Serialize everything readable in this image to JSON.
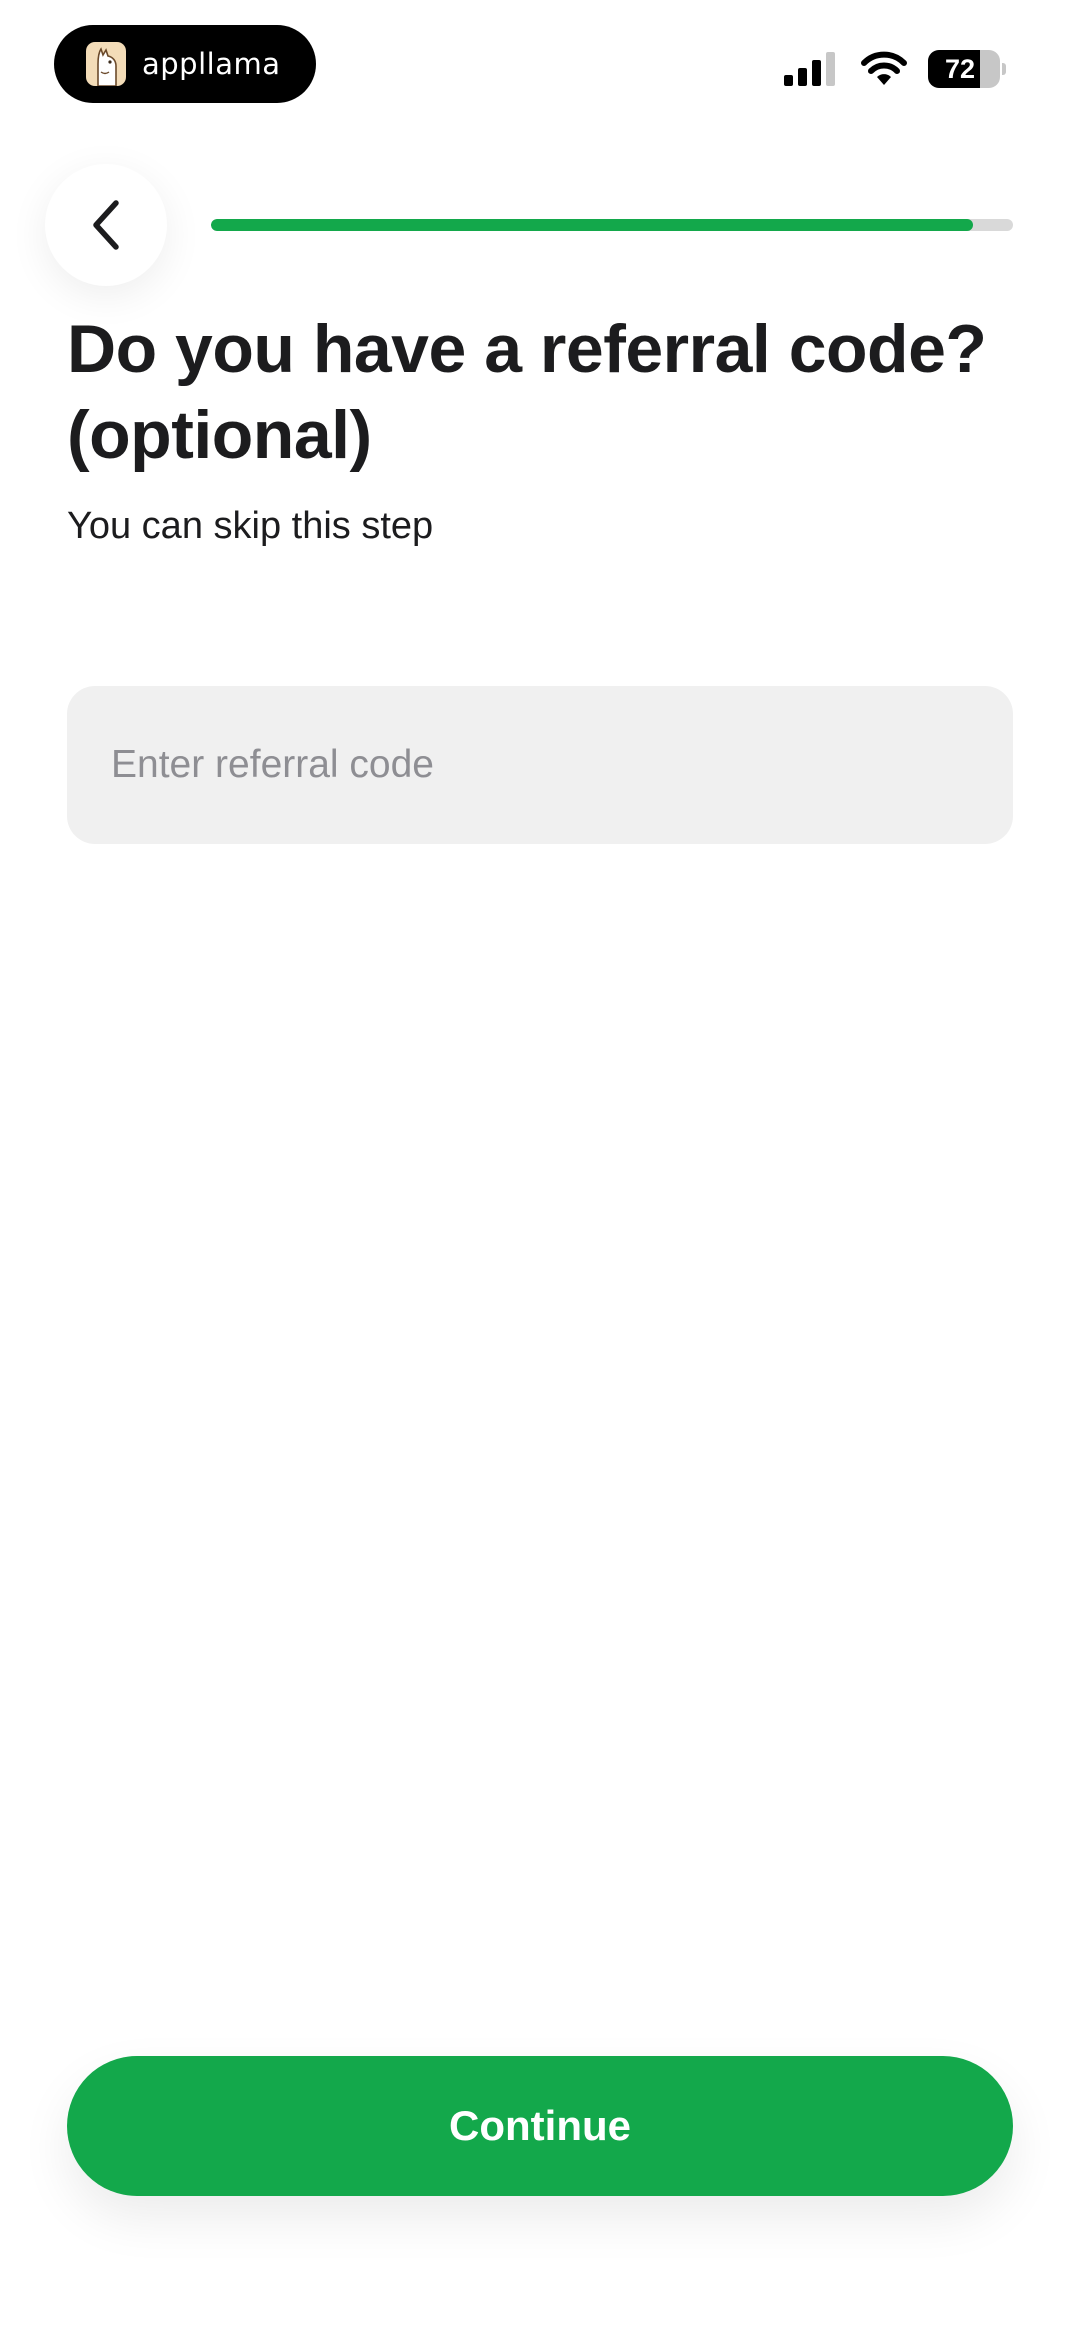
{
  "status_bar": {
    "app_pill": {
      "name": "appllama",
      "logo_icon": "llama-logo-icon"
    },
    "signal_icon": "cellular-signal-icon",
    "wifi_icon": "wifi-icon",
    "battery": {
      "icon": "battery-icon",
      "level_text": "72",
      "level_fraction": 0.72
    }
  },
  "header": {
    "back_icon": "chevron-left-icon",
    "progress_fraction": 0.95
  },
  "main": {
    "title": "Do you have a referral code? (optional)",
    "subtitle": "You can skip this step",
    "referral_input": {
      "placeholder": "Enter referral code",
      "value": ""
    }
  },
  "footer": {
    "continue_label": "Continue"
  },
  "colors": {
    "accent": "#13a84b",
    "progress_track": "#d9d9d9",
    "input_background": "#f0f0f0",
    "text_primary": "#1c1c1e",
    "placeholder": "#8e8e93"
  }
}
